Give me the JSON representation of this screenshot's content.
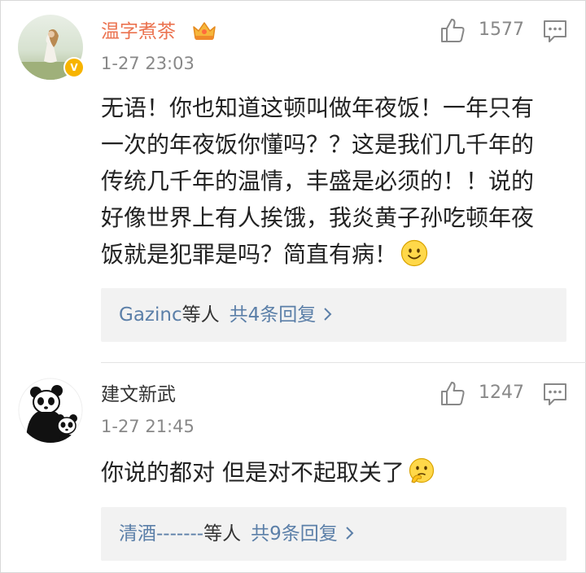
{
  "colors": {
    "vip_name": "#eb7350",
    "link": "#5b7fa8",
    "meta": "#888888",
    "reply_box_bg": "#f2f2f2"
  },
  "comments": [
    {
      "username": "温字煮茶",
      "vip_badge_icon": "crown-icon",
      "verified_badge": "V",
      "timestamp": "1-27 23:03",
      "like_count": "1577",
      "body_lines": [
        "无语！你也知道这顿叫做年夜饭！一年只有",
        "一次的年夜饭你懂吗？？这是我们几千年的",
        "传统几千年的温情，丰盛是必须的！！说的",
        "好像世界上有人挨饿，我炎黄子孙吃顿年夜",
        "饭就是犯罪是吗？简直有病！"
      ],
      "body_emoji": "smile-emoji",
      "replies": {
        "names": "Gazinc",
        "suffix": "等人",
        "count_label": "共4条回复"
      }
    },
    {
      "username": "建文新武",
      "timestamp": "1-27 21:45",
      "like_count": "1247",
      "body_lines": [
        "你说的都对 但是对不起取关了"
      ],
      "body_emoji": "thinking-emoji",
      "replies": {
        "names": "清酒-------",
        "suffix": "等人",
        "count_label": "共9条回复"
      }
    }
  ]
}
